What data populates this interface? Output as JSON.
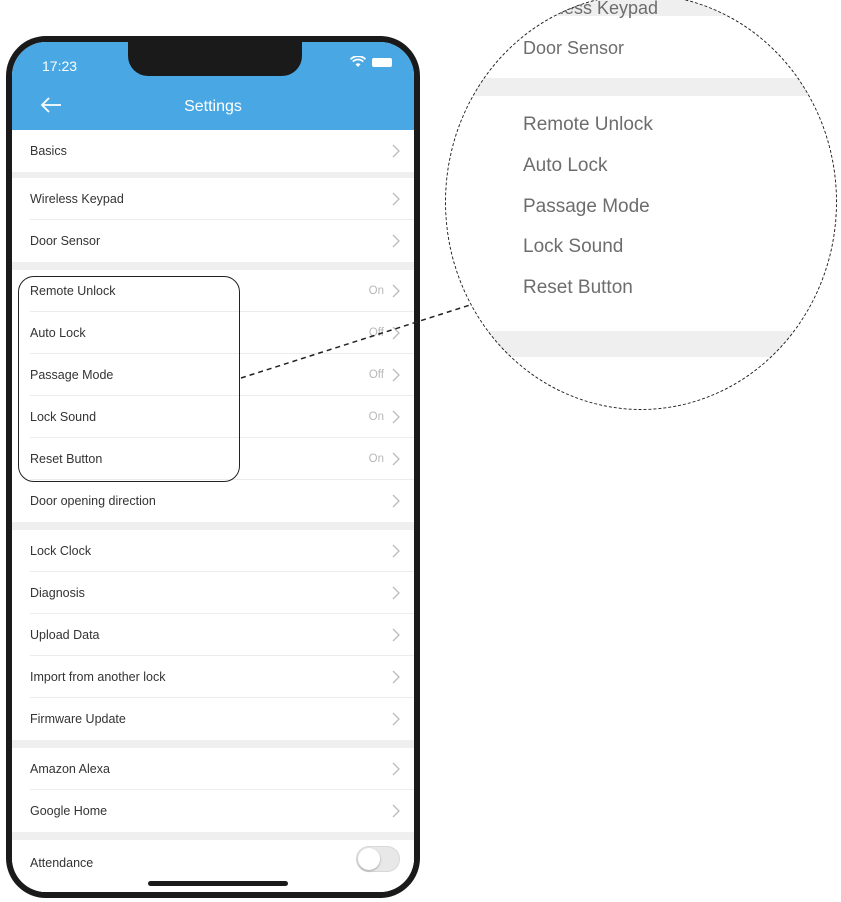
{
  "status_bar": {
    "time": "17:23"
  },
  "header": {
    "title": "Settings"
  },
  "rows": [
    {
      "label": "Basics"
    },
    {
      "label": "Wireless Keypad"
    },
    {
      "label": "Door Sensor"
    },
    {
      "label": "Remote Unlock",
      "value": "On"
    },
    {
      "label": "Auto Lock",
      "value": "Off"
    },
    {
      "label": "Passage Mode",
      "value": "Off"
    },
    {
      "label": "Lock Sound",
      "value": "On"
    },
    {
      "label": "Reset Button",
      "value": "On"
    },
    {
      "label": "Door opening direction"
    },
    {
      "label": "Lock Clock"
    },
    {
      "label": "Diagnosis"
    },
    {
      "label": "Upload Data"
    },
    {
      "label": "Import from another lock"
    },
    {
      "label": "Firmware Update"
    },
    {
      "label": "Amazon Alexa"
    },
    {
      "label": "Google Home"
    },
    {
      "label": "Attendance",
      "toggle": false
    }
  ],
  "zoom": {
    "items": [
      "Wireless Keypad",
      "Door Sensor",
      "Remote Unlock",
      "Auto Lock",
      "Passage Mode",
      "Lock Sound",
      "Reset Button"
    ]
  },
  "colors": {
    "header_bg": "#49a8e3",
    "section_gap": "#efefef",
    "accent": "#49a8e3"
  }
}
